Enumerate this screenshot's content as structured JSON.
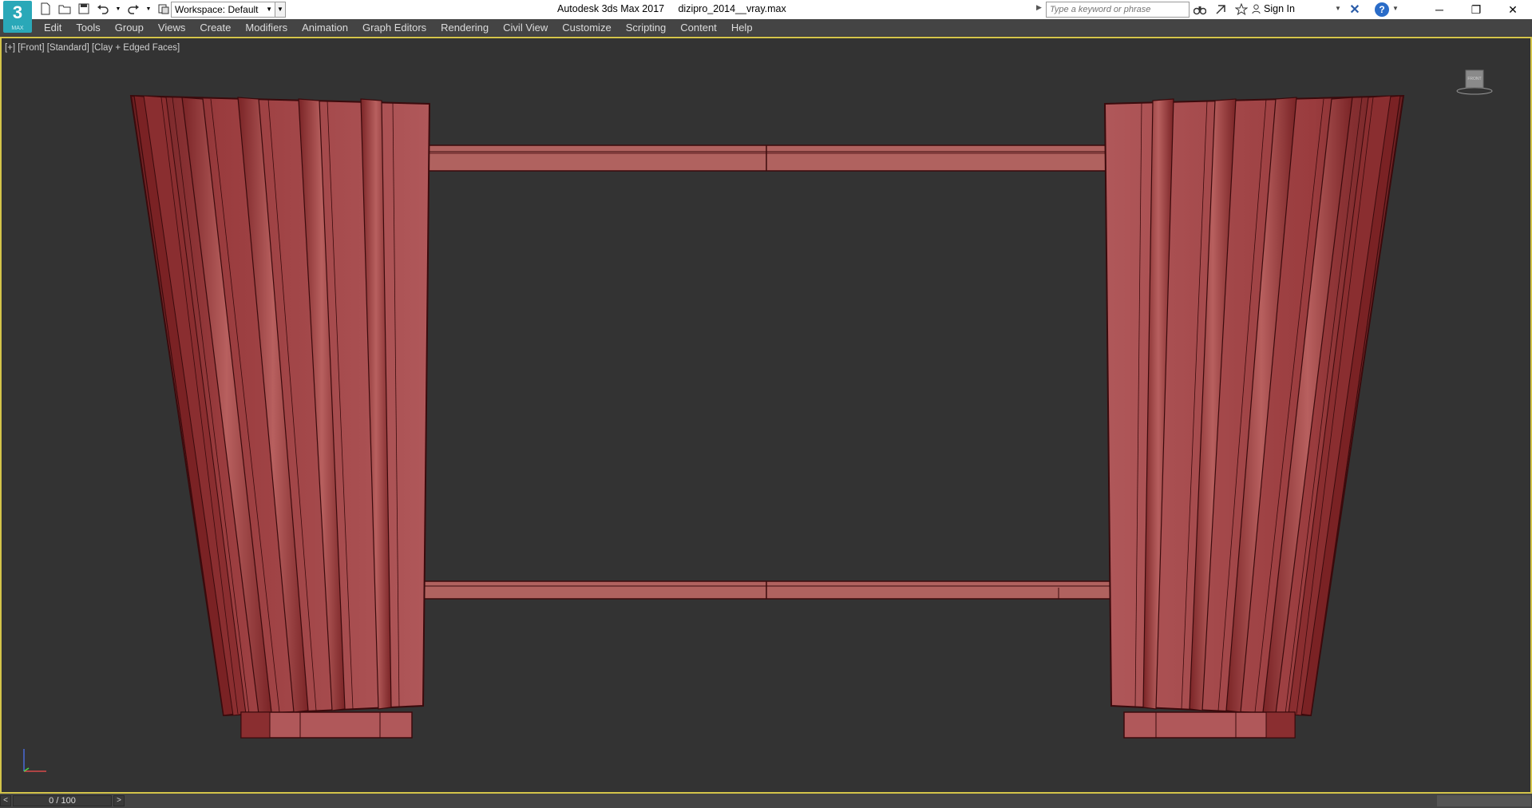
{
  "app": {
    "logo_text": "3",
    "logo_sub": "MAX",
    "title": "Autodesk 3ds Max 2017     dizipro_2014__vray.max"
  },
  "workspace": {
    "label": "Workspace: Default"
  },
  "search": {
    "placeholder": "Type a keyword or phrase"
  },
  "signin": {
    "label": "Sign In"
  },
  "window_controls": {
    "minimize": "─",
    "restore": "❐",
    "close": "✕"
  },
  "menu": {
    "items": [
      "Edit",
      "Tools",
      "Group",
      "Views",
      "Create",
      "Modifiers",
      "Animation",
      "Graph Editors",
      "Rendering",
      "Civil View",
      "Customize",
      "Scripting",
      "Content",
      "Help"
    ]
  },
  "viewport": {
    "label": "[+] [Front] [Standard] [Clay + Edged Faces]",
    "viewcube_label": "FRONT"
  },
  "timeslider": {
    "frame_display": "0 / 100",
    "prev": "<",
    "next": ">"
  },
  "colors": {
    "accent_border": "#d4c44a",
    "curtain_fill": "#a84a4c",
    "curtain_edge": "#4a0c0e"
  }
}
